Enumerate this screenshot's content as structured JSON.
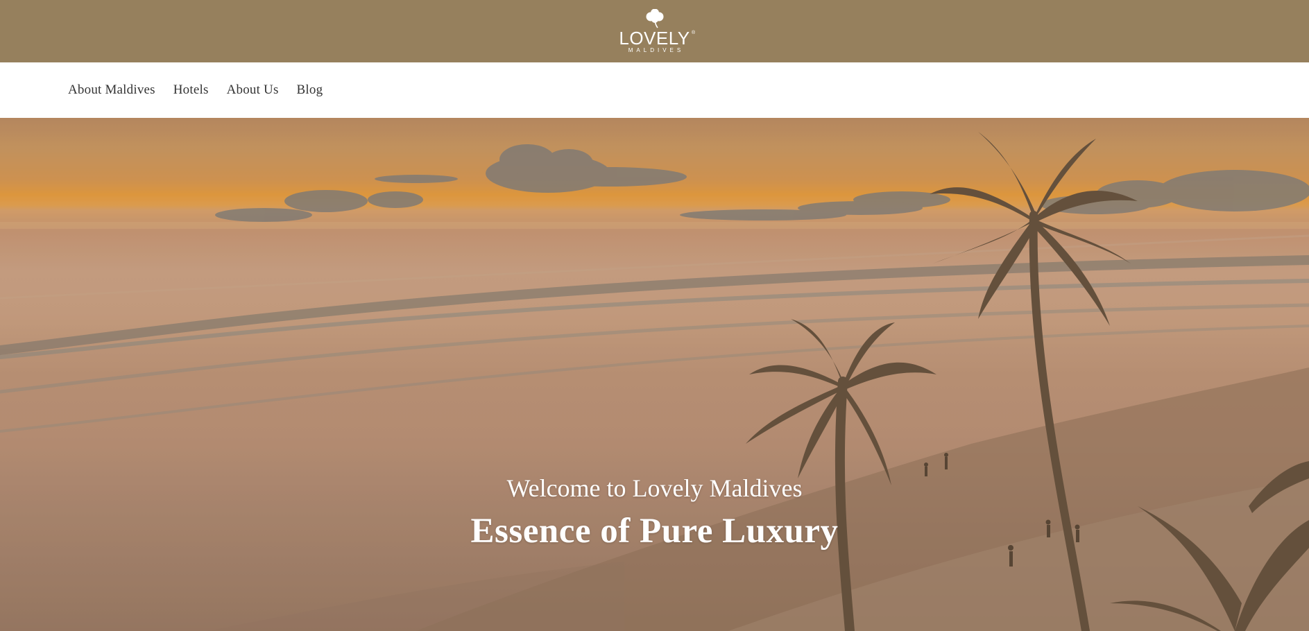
{
  "colors": {
    "topbar_bg": "#96805d",
    "navbar_bg": "#ffffff",
    "nav_text": "#333333",
    "hero_text": "#ffffff"
  },
  "brand": {
    "logo_icon": "clover-icon",
    "name": "LOVELY",
    "registered": "®",
    "subtitle": "MALDIVES"
  },
  "nav": {
    "items": [
      {
        "label": "About Maldives"
      },
      {
        "label": "Hotels"
      },
      {
        "label": "About Us"
      },
      {
        "label": "Blog"
      }
    ]
  },
  "hero": {
    "welcome": "Welcome to Lovely Maldives",
    "title": "Essence of Pure Luxury",
    "image_icon": "beach-sunset-image"
  }
}
